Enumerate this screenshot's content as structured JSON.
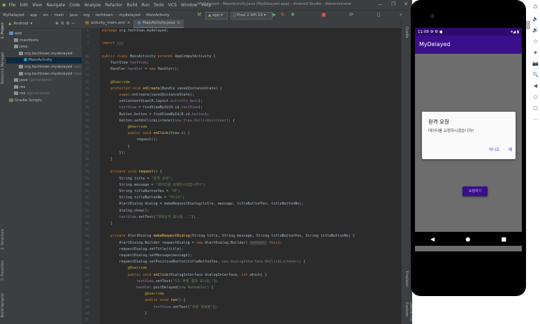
{
  "window": {
    "title": "MyDelayed - MainActivity.java [MyDelayed.app] - Android Studio - Administrator",
    "menu": [
      "File",
      "Edit",
      "View",
      "Navigate",
      "Code",
      "Analyze",
      "Refactor",
      "Build",
      "Run",
      "Tools",
      "VCS",
      "Window",
      "Help"
    ],
    "controls": [
      "—",
      "❐",
      "✕"
    ]
  },
  "nav": {
    "breadcrumbs": [
      "MyDelayed",
      "app",
      "src",
      "main",
      "java",
      "org",
      "techtown",
      "mydelayed",
      "MainActivity"
    ],
    "run_config": "app",
    "device": "Pixel 2 API 29"
  },
  "project_panel": {
    "title": "Android",
    "tree": [
      {
        "label": "app",
        "indent": 0,
        "icon": "folder-blue"
      },
      {
        "label": "manifests",
        "indent": 1,
        "icon": "folder"
      },
      {
        "label": "java",
        "indent": 1,
        "icon": "folder"
      },
      {
        "label": "org.techtown.mydelayed",
        "indent": 2,
        "icon": "folder"
      },
      {
        "label": "MainActivity",
        "indent": 3,
        "icon": "class",
        "selected": true
      },
      {
        "label": "org.techtown.mydelayed",
        "suffix": "(andr",
        "indent": 2,
        "icon": "folder"
      },
      {
        "label": "org.techtown.mydelayed",
        "suffix": "(test",
        "indent": 2,
        "icon": "folder"
      },
      {
        "label": "java",
        "suffix": "(generated)",
        "indent": 1,
        "icon": "folder"
      },
      {
        "label": "res",
        "indent": 1,
        "icon": "folder"
      },
      {
        "label": "res",
        "suffix": "(generated)",
        "indent": 1,
        "icon": "folder"
      },
      {
        "label": "Gradle Scripts",
        "indent": 0,
        "icon": "gradle"
      }
    ]
  },
  "left_strip": [
    "1: Project",
    "Resource Manager",
    "2: Structure",
    "2: Favorites",
    "Build Variants"
  ],
  "right_strip": [
    "Gradle",
    "Emulator",
    "Device File Explorer"
  ],
  "tabs": [
    {
      "label": "activity_main.xml",
      "active": false
    },
    {
      "label": "MainActivity.java",
      "active": true
    }
  ],
  "code": {
    "line_numbers": [
      "1",
      "2",
      "3",
      "",
      "10",
      "11",
      "12",
      "13",
      "14",
      "15",
      "16",
      "17",
      "18",
      "19",
      "20",
      "21",
      "22",
      "23",
      "24",
      "25",
      "26",
      "27",
      "28",
      "29",
      "30",
      "31",
      "32",
      "33",
      "34",
      "35",
      "36",
      "37",
      "38",
      "39",
      "40",
      "41",
      "42",
      "43",
      "44",
      "45",
      "46",
      "47",
      "48",
      "49",
      "50",
      "51"
    ],
    "lines": [
      "<span class='kw'>package</span> org.techtown.mydelayed;",
      "",
      "<span class='kw'>import</span> <span class='hint'>...</span>",
      "",
      "<span class='kw'>public class</span> MainActivity <span class='kw'>extends</span> AppCompatActivity {",
      "    TextView <span class='fld'>textView</span>;",
      "    Handler <span class='fld'>handler</span> = <span class='kw'>new</span> Handler();",
      "",
      "    <span class='ann'>@Override</span>",
      "    <span class='kw'>protected void</span> <span class='mth'>onCreate</span>(Bundle savedInstanceState) {",
      "        <span class='kw'>super</span>.onCreate(savedInstanceState);",
      "        setContentView(R.layout.<span class='fld'>activity_main</span>);",
      "        <span class='fld'>textView</span> = findViewById(R.id.<span class='fld'>textView</span>);",
      "        Button button = findViewById(R.id.<span class='fld'>button</span>);",
      "        button.setOnClickListener(<span class='cmt'>new View.OnClickListener()</span> {",
      "            <span class='ann'>@Override</span>",
      "            <span class='kw'>public void</span> <span class='mth'>onClick</span>(View v) {",
      "                request();",
      "            }",
      "        });",
      "    }",
      "",
      "    <span class='kw'>private void</span> <span class='mth'>request</span>() {",
      "        String title = <span class='str'>\"원격 요청\"</span>;",
      "        String message = <span class='str'>\"데이터를 요청하시겠습니까?\"</span>;",
      "        String titleButtonYes = <span class='str'>\"예\"</span>;",
      "        String titleButtonNo = <span class='str'>\"아니오\"</span>;",
      "        AlertDialog dialog = makeRequestDialog(title, message, titleButtonYes, titleButtonNo);",
      "        dialog.show();",
      "        <span class='fld'>textView</span>.setText(<span class='str'>\"대화상자 표시중...\"</span>);",
      "    }",
      "",
      "    <span class='kw'>private</span> AlertDialog <span class='mth'>makeRequestDialog</span>(String title, String message, String titleButtonYes, String titleButtonNo) {",
      "        AlertDialog.Builder requestDialog = <span class='kw'>new</span> AlertDialog.Builder( <span class='hint'>context:</span> <span class='kw'>this</span>);",
      "        requestDialog.setTitle(title);",
      "        requestDialog.setMessage(message);",
      "        requestDialog.setPositiveButton(titleButtonYes, <span class='cmt'>new DialogInterface.OnClickListener()</span> {",
      "            <span class='ann'>@Override</span>",
      "            <span class='kw'>public void</span> <span class='mth'>onClick</span>(DialogInterface dialogInterface, <span class='kw'>int</span> which) {",
      "                <span class='fld'>textView</span>.setText(<span class='str'>\"5초 후에 결과 표시됨.\"</span>);",
      "                <span class='fld'>handler</span>.postDelayed(<span class='cmt'>new Runnable()</span> {",
      "                    <span class='ann'>@Override</span>",
      "                    <span class='kw'>public void</span> <span class='mth'>run</span>() {",
      "                        <span class='fld'>textView</span>.setText(<span class='str'>\"요청 완료됨\"</span>);",
      "                    }",
      ""
    ]
  },
  "phone": {
    "status_time": "11:08",
    "status_icons": "⚙ ⚙ ◼",
    "status_right": "▾◢ ▮",
    "app_title": "MyDelayed",
    "dialog": {
      "title": "원격 요청",
      "message": "데이터를 요청하시겠습니까?",
      "negative": "아니오",
      "positive": "예"
    },
    "request_button": "요청하기",
    "nav_back": "◀",
    "nav_home": "●",
    "nav_recent": "■"
  },
  "emulator_tools": [
    "⏻",
    "🔈",
    "🔊",
    "◇",
    "◈",
    "📷",
    "🔍",
    "◀",
    "○",
    "□",
    "⋯"
  ]
}
